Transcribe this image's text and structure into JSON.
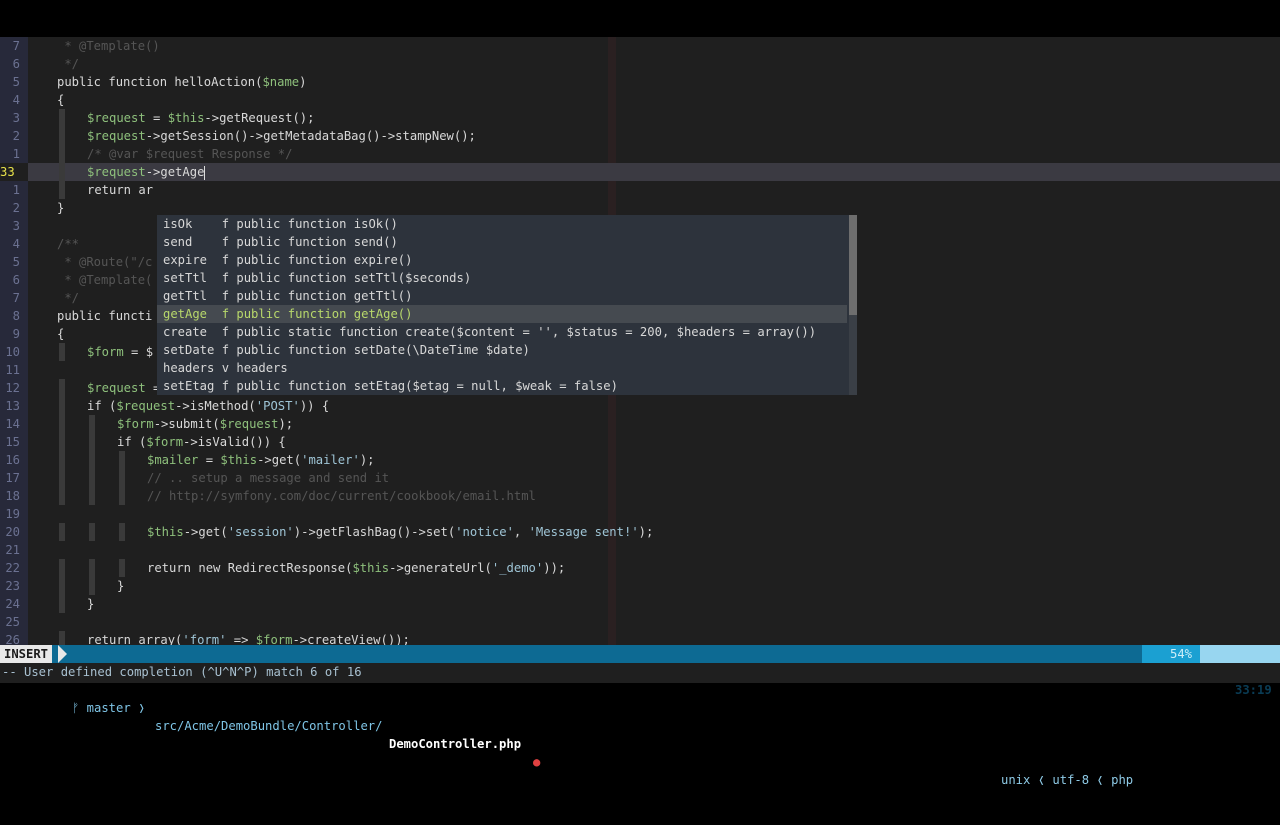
{
  "editor": {
    "lines": [
      {
        "num": "7",
        "indent": 0,
        "code": " * @Template()",
        "type": "comment"
      },
      {
        "num": "6",
        "indent": 0,
        "code": " */",
        "type": "comment"
      },
      {
        "num": "5",
        "indent": 0,
        "code": "public function helloAction($name)",
        "type": "code"
      },
      {
        "num": "4",
        "indent": 0,
        "code": "{",
        "type": "code"
      },
      {
        "num": "3",
        "indent": 1,
        "code": "$request = $this->getRequest();",
        "type": "code"
      },
      {
        "num": "2",
        "indent": 1,
        "code": "$request->getSession()->getMetadataBag()->stampNew();",
        "type": "code"
      },
      {
        "num": "1",
        "indent": 1,
        "code": "/* @var $request Response */",
        "type": "comment"
      },
      {
        "num": "33",
        "indent": 1,
        "code": "$request->getAge",
        "type": "current"
      },
      {
        "num": "1",
        "indent": 1,
        "code": "return ar",
        "type": "code"
      },
      {
        "num": "2",
        "indent": 0,
        "code": "}",
        "type": "code"
      },
      {
        "num": "3",
        "indent": 0,
        "code": "",
        "type": "code"
      },
      {
        "num": "4",
        "indent": 0,
        "code": "/**",
        "type": "comment"
      },
      {
        "num": "5",
        "indent": 0,
        "code": " * @Route(\"/c",
        "type": "comment"
      },
      {
        "num": "6",
        "indent": 0,
        "code": " * @Template(",
        "type": "comment"
      },
      {
        "num": "7",
        "indent": 0,
        "code": " */",
        "type": "comment"
      },
      {
        "num": "8",
        "indent": 0,
        "code": "public functi",
        "type": "code"
      },
      {
        "num": "9",
        "indent": 0,
        "code": "{",
        "type": "code"
      },
      {
        "num": "10",
        "indent": 1,
        "code": "$form = $",
        "type": "code"
      },
      {
        "num": "11",
        "indent": 0,
        "code": "",
        "type": "code"
      },
      {
        "num": "12",
        "indent": 1,
        "code": "$request = $this->get('request');",
        "type": "code"
      },
      {
        "num": "13",
        "indent": 1,
        "code": "if ($request->isMethod('POST')) {",
        "type": "code"
      },
      {
        "num": "14",
        "indent": 2,
        "code": "$form->submit($request);",
        "type": "code"
      },
      {
        "num": "15",
        "indent": 2,
        "code": "if ($form->isValid()) {",
        "type": "code"
      },
      {
        "num": "16",
        "indent": 3,
        "code": "$mailer = $this->get('mailer');",
        "type": "code"
      },
      {
        "num": "17",
        "indent": 3,
        "code": "// .. setup a message and send it",
        "type": "comment"
      },
      {
        "num": "18",
        "indent": 3,
        "code": "// http://symfony.com/doc/current/cookbook/email.html",
        "type": "comment"
      },
      {
        "num": "19",
        "indent": 0,
        "code": "",
        "type": "code"
      },
      {
        "num": "20",
        "indent": 3,
        "code": "$this->get('session')->getFlashBag()->set('notice', 'Message sent!');",
        "type": "code"
      },
      {
        "num": "21",
        "indent": 0,
        "code": "",
        "type": "code"
      },
      {
        "num": "22",
        "indent": 3,
        "code": "return new RedirectResponse($this->generateUrl('_demo'));",
        "type": "code"
      },
      {
        "num": "23",
        "indent": 2,
        "code": "}",
        "type": "code"
      },
      {
        "num": "24",
        "indent": 1,
        "code": "}",
        "type": "code"
      },
      {
        "num": "25",
        "indent": 0,
        "code": "",
        "type": "code"
      },
      {
        "num": "26",
        "indent": 1,
        "code": "return array('form' => $form->createView());",
        "type": "code"
      }
    ]
  },
  "completion": {
    "items": [
      {
        "word": "isOk   ",
        "kind": "f",
        "menu": "public function isOk()"
      },
      {
        "word": "send   ",
        "kind": "f",
        "menu": "public function send()"
      },
      {
        "word": "expire ",
        "kind": "f",
        "menu": "public function expire()"
      },
      {
        "word": "setTtl ",
        "kind": "f",
        "menu": "public function setTtl($seconds)"
      },
      {
        "word": "getTtl ",
        "kind": "f",
        "menu": "public function getTtl()"
      },
      {
        "word": "getAge ",
        "kind": "f",
        "menu": "public function getAge()"
      },
      {
        "word": "create ",
        "kind": "f",
        "menu": "public static function create($content = '', $status = 200, $headers = array())"
      },
      {
        "word": "setDate",
        "kind": "f",
        "menu": "public function setDate(\\DateTime $date)"
      },
      {
        "word": "headers",
        "kind": "v",
        "menu": "headers"
      },
      {
        "word": "setEtag",
        "kind": "f",
        "menu": "public function setEtag($etag = null, $weak = false)"
      }
    ],
    "selected_index": 5
  },
  "statusline": {
    "mode": "INSERT",
    "branch_icon": "git-branch-icon",
    "branch": "master",
    "path": "src/Acme/DemoBundle/Controller/",
    "filename": "DemoController.php",
    "modified_marker": "●",
    "fileformat": "unix",
    "encoding": "utf-8",
    "filetype": "php",
    "sep": "❬",
    "percent": "54%",
    "line_icon": "LN",
    "position": "33:19"
  },
  "cmdline": {
    "text": "-- User defined completion (^U^N^P) match 6 of 16"
  }
}
